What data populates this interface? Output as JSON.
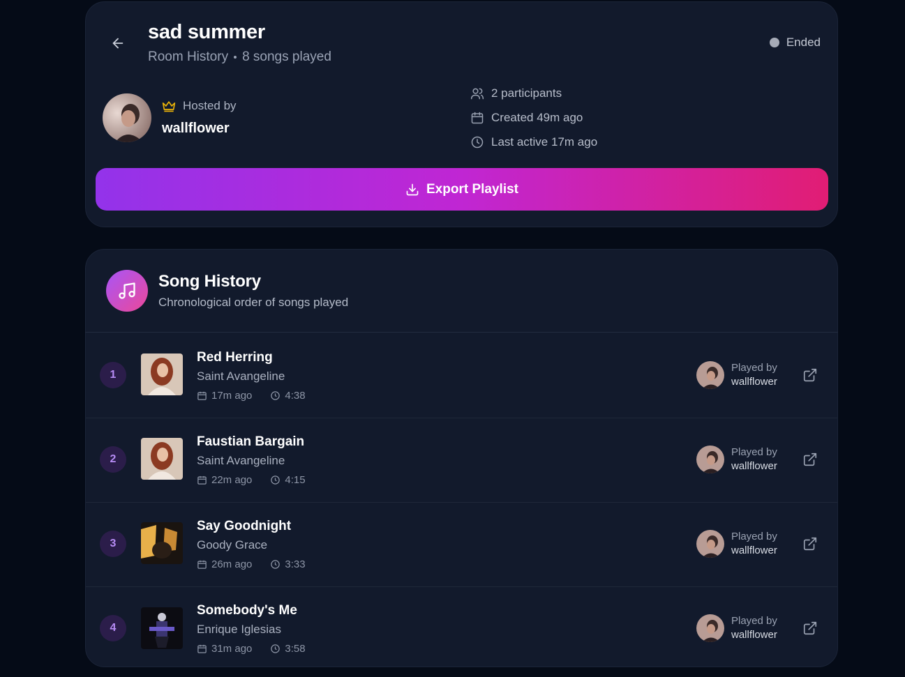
{
  "room": {
    "title": "sad summer",
    "subtitle_label": "Room History",
    "songs_played": "8 songs played",
    "status": "Ended",
    "hosted_by_label": "Hosted by",
    "host_name": "wallflower",
    "participants": "2 participants",
    "created": "Created 49m ago",
    "last_active": "Last active 17m ago",
    "export_label": "Export Playlist"
  },
  "history": {
    "title": "Song History",
    "subtitle": "Chronological order of songs played",
    "played_by_label": "Played by",
    "songs": [
      {
        "num": "1",
        "title": "Red Herring",
        "artist": "Saint Avangeline",
        "ago": "17m ago",
        "duration": "4:38",
        "played_by": "wallflower"
      },
      {
        "num": "2",
        "title": "Faustian Bargain",
        "artist": "Saint Avangeline",
        "ago": "22m ago",
        "duration": "4:15",
        "played_by": "wallflower"
      },
      {
        "num": "3",
        "title": "Say Goodnight",
        "artist": "Goody Grace",
        "ago": "26m ago",
        "duration": "3:33",
        "played_by": "wallflower"
      },
      {
        "num": "4",
        "title": "Somebody's Me",
        "artist": "Enrique Iglesias",
        "ago": "31m ago",
        "duration": "3:58",
        "played_by": "wallflower"
      }
    ]
  },
  "colors": {
    "background": "#050b17",
    "card": "#121a2c",
    "accent_start": "#9333ea",
    "accent_end": "#e11d74",
    "crown": "#eab308"
  },
  "icons": [
    "arrow-left-icon",
    "crown-icon",
    "users-icon",
    "calendar-icon",
    "clock-icon",
    "download-icon",
    "music-note-icon",
    "external-link-icon"
  ]
}
